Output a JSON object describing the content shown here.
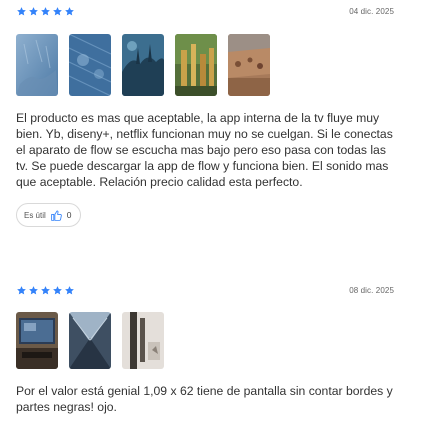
{
  "reviews": [
    {
      "rating": 5,
      "date": "04 dic. 2025",
      "photos": [
        {
          "icon": "photo-blue-mist"
        },
        {
          "icon": "photo-blue-rain"
        },
        {
          "icon": "photo-blue-silhouette"
        },
        {
          "icon": "photo-city-lights"
        },
        {
          "icon": "photo-desert-wall"
        }
      ],
      "text": "El producto es mas que aceptable, la app interna de la tv fluye muy bien. Yb, diseny+, netflix funcionan muy no se cuelgan. Si le conectas el aparato de flow se escucha mas bajo pero eso pasa con todas las tv. Se puede descargar la app de flow y funciona bien. El sonido mas que aceptable. Relación precio calidad esta perfecto.",
      "helpful_label": "Es útil",
      "helpful_count": "0"
    },
    {
      "rating": 5,
      "date": "08 dic. 2025",
      "photos": [
        {
          "icon": "photo-tv-stand"
        },
        {
          "icon": "photo-tv-box"
        },
        {
          "icon": "photo-wall-tv"
        }
      ],
      "text": "Por el valor está genial 1,09 x 62 tiene de pantalla sin contar bordes y partes negras! ojo."
    }
  ],
  "colors": {
    "star": "#3483fa",
    "text": "#333333",
    "date": "#666666",
    "border": "#d9d9d9"
  }
}
